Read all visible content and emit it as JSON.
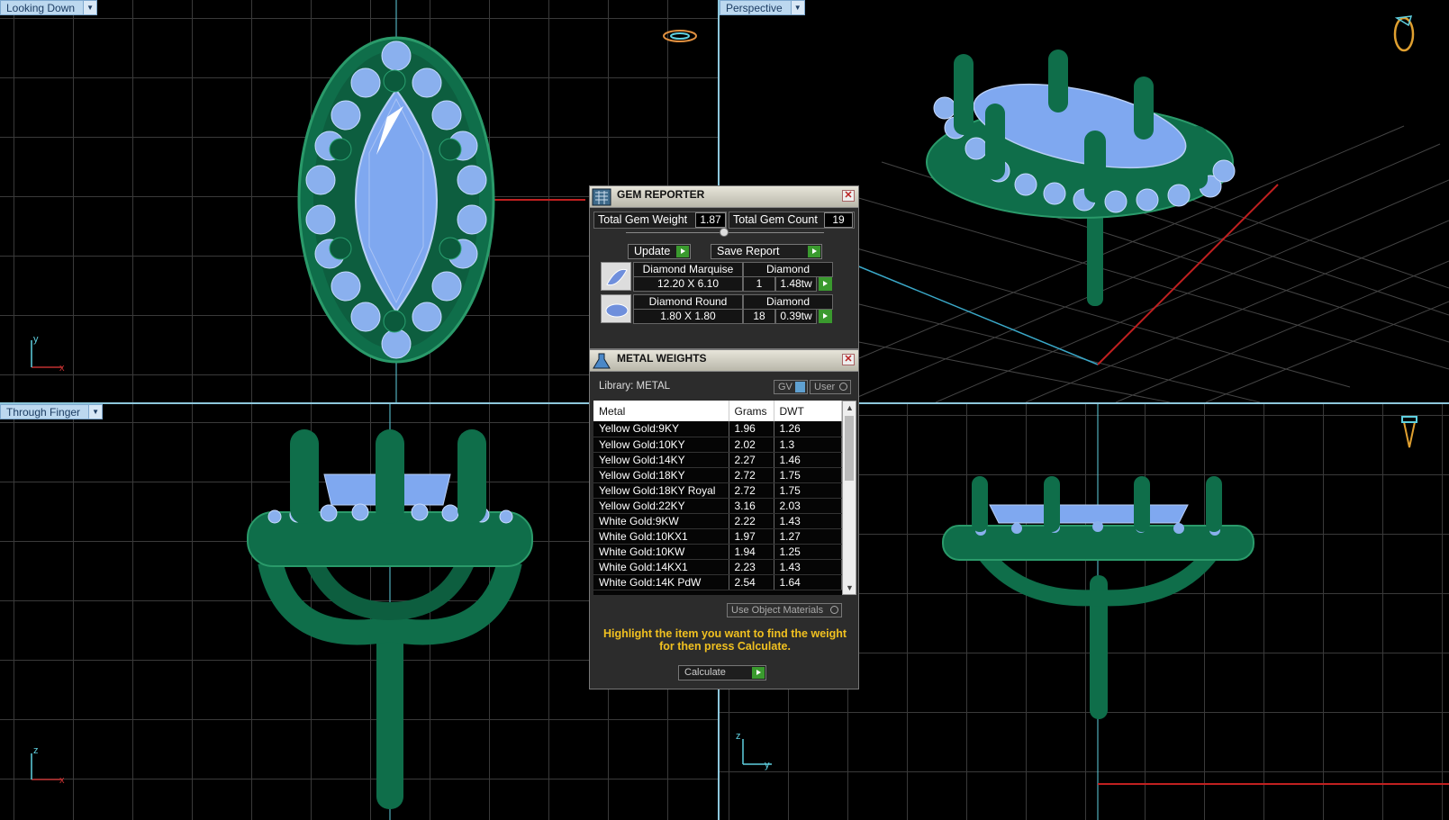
{
  "viewports": {
    "top_left_label": "Looking Down",
    "top_right_label": "Perspective",
    "bottom_left_label": "Through Finger"
  },
  "axes": {
    "tl": [
      "y",
      "x"
    ],
    "bl": [
      "z",
      "x"
    ],
    "br": [
      "z",
      "y"
    ]
  },
  "gem_reporter": {
    "title": "GEM REPORTER",
    "total_weight_label": "Total Gem Weight",
    "total_weight_value": "1.87",
    "total_count_label": "Total Gem Count",
    "total_count_value": "19",
    "update_label": "Update",
    "save_report_label": "Save Report",
    "gems": [
      {
        "name": "Diamond Marquise",
        "material": "Diamond",
        "size": "12.20 X 6.10",
        "count": "1",
        "weight": "1.48tw"
      },
      {
        "name": "Diamond Round",
        "material": "Diamond",
        "size": "1.80 X 1.80",
        "count": "18",
        "weight": "0.39tw"
      }
    ]
  },
  "metal_weights": {
    "title": "METAL WEIGHTS",
    "library_label": "Library: METAL",
    "gv_label": "GV",
    "user_label": "User",
    "columns": [
      "Metal",
      "Grams",
      "DWT"
    ],
    "rows": [
      [
        "Yellow Gold:9KY",
        "1.96",
        "1.26"
      ],
      [
        "Yellow Gold:10KY",
        "2.02",
        "1.3"
      ],
      [
        "Yellow Gold:14KY",
        "2.27",
        "1.46"
      ],
      [
        "Yellow Gold:18KY",
        "2.72",
        "1.75"
      ],
      [
        "Yellow Gold:18KY Royal",
        "2.72",
        "1.75"
      ],
      [
        "Yellow Gold:22KY",
        "3.16",
        "2.03"
      ],
      [
        "White Gold:9KW",
        "2.22",
        "1.43"
      ],
      [
        "White Gold:10KX1",
        "1.97",
        "1.27"
      ],
      [
        "White Gold:10KW",
        "1.94",
        "1.25"
      ],
      [
        "White Gold:14KX1",
        "2.23",
        "1.43"
      ],
      [
        "White Gold:14K PdW",
        "2.54",
        "1.64"
      ]
    ],
    "use_object_materials_label": "Use Object Materials",
    "hint_line1": "Highlight the item you want to find the weight",
    "hint_line2": "for then press Calculate.",
    "calculate_label": "Calculate"
  },
  "colors": {
    "metal_green": "#0f6e4a",
    "gem_blue": "#7fa8f0",
    "grid_line": "#3a3a3a",
    "hint_yellow": "#f0c020"
  }
}
